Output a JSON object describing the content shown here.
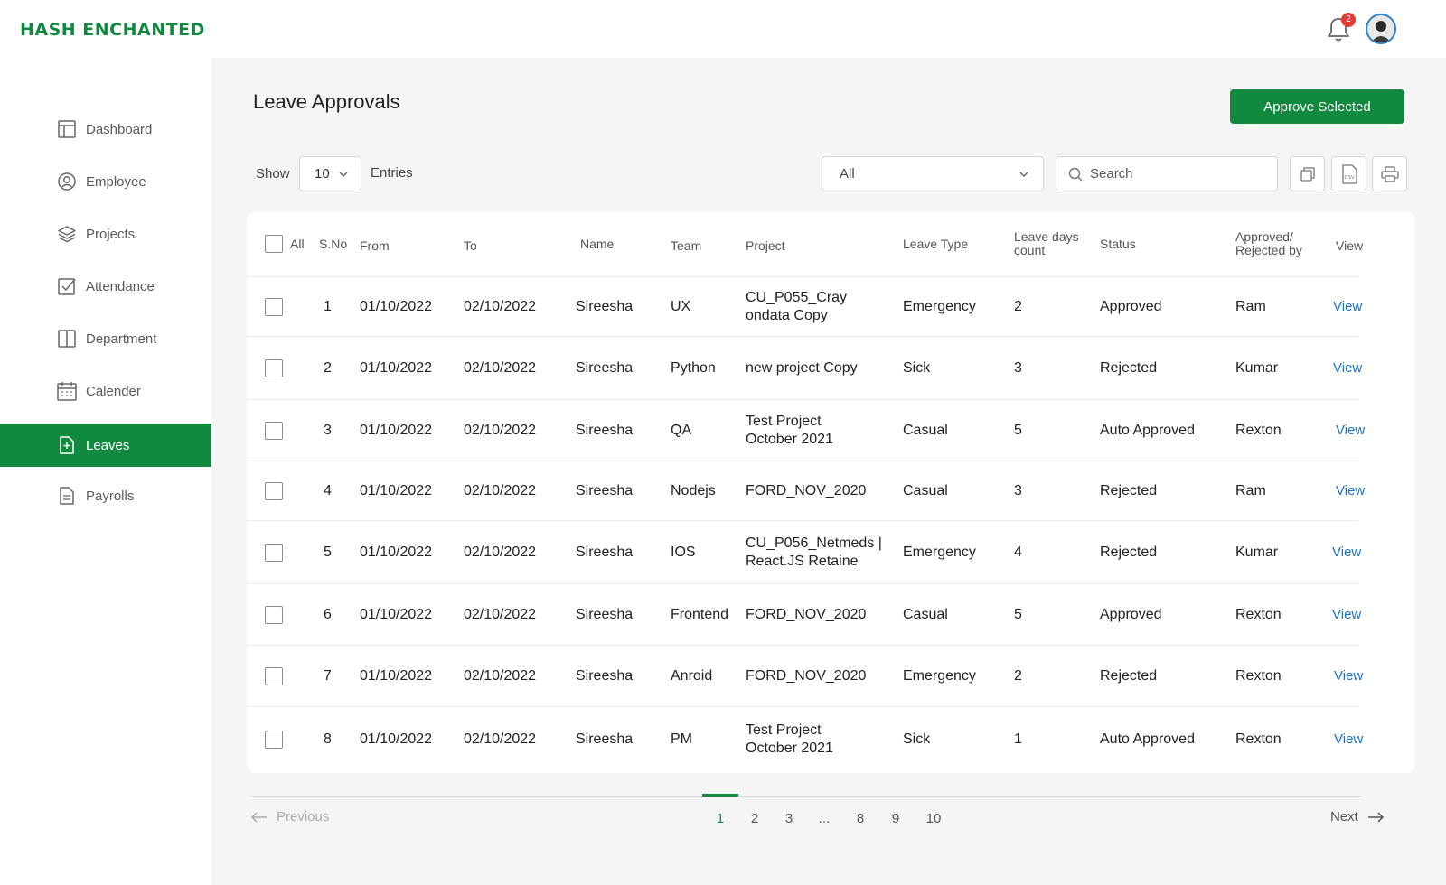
{
  "brand": {
    "logo_text": "HASH ENCHANTED",
    "accent": "#118a3f"
  },
  "header": {
    "notification_count": "2"
  },
  "sidebar": {
    "items": [
      {
        "label": "Dashboard",
        "icon": "dashboard-icon"
      },
      {
        "label": "Employee",
        "icon": "user-circle-icon"
      },
      {
        "label": "Projects",
        "icon": "layers-icon"
      },
      {
        "label": "Attendance",
        "icon": "checkbox-icon"
      },
      {
        "label": "Department",
        "icon": "columns-icon"
      },
      {
        "label": "Calender",
        "icon": "calendar-icon"
      },
      {
        "label": "Leaves",
        "icon": "file-plus-icon",
        "active": true
      },
      {
        "label": "Payrolls",
        "icon": "file-text-icon"
      }
    ]
  },
  "page": {
    "title": "Leave Approvals",
    "approve_button": "Approve Selected"
  },
  "controls": {
    "show_label": "Show",
    "entries_value": "10",
    "entries_label": "Entries",
    "filter_value": "All",
    "search_placeholder": "Search"
  },
  "table": {
    "headers": {
      "all": "All",
      "sno": "S.No",
      "from": "From",
      "to": "To",
      "name": "Name",
      "team": "Team",
      "project": "Project",
      "leave_type": "Leave Type",
      "leave_days_1": "Leave days",
      "leave_days_2": "count",
      "status": "Status",
      "approved_1": "Approved/",
      "approved_2": "Rejected by",
      "view": "View"
    },
    "rows": [
      {
        "sno": "1",
        "from": "01/10/2022",
        "to": "02/10/2022",
        "name": "Sireesha",
        "team": "UX",
        "project_1": "CU_P055_Cray",
        "project_2": "ondata Copy",
        "leave_type": "Emergency",
        "days": "2",
        "status": "Approved",
        "by": "Ram",
        "view": "View"
      },
      {
        "sno": "2",
        "from": "01/10/2022",
        "to": "02/10/2022",
        "name": "Sireesha",
        "team": "Python",
        "project_1": "new project Copy",
        "project_2": "",
        "leave_type": "Sick",
        "days": "3",
        "status": "Rejected",
        "by": "Kumar",
        "view": "View"
      },
      {
        "sno": "3",
        "from": "01/10/2022",
        "to": "02/10/2022",
        "name": "Sireesha",
        "team": "QA",
        "project_1": "Test Project",
        "project_2": "October 2021",
        "leave_type": "Casual",
        "days": "5",
        "status": "Auto Approved",
        "by": "Rexton",
        "view": "View"
      },
      {
        "sno": "4",
        "from": "01/10/2022",
        "to": "02/10/2022",
        "name": "Sireesha",
        "team": "Nodejs",
        "project_1": "FORD_NOV_2020",
        "project_2": "",
        "leave_type": "Casual",
        "days": "3",
        "status": "Rejected",
        "by": "Ram",
        "view": "View"
      },
      {
        "sno": "5",
        "from": "01/10/2022",
        "to": "02/10/2022",
        "name": "Sireesha",
        "team": "IOS",
        "project_1": "CU_P056_Netmeds |",
        "project_2": "React.JS Retaine",
        "leave_type": "Emergency",
        "days": "4",
        "status": "Rejected",
        "by": "Kumar",
        "view": "View"
      },
      {
        "sno": "6",
        "from": "01/10/2022",
        "to": "02/10/2022",
        "name": "Sireesha",
        "team": "Frontend",
        "project_1": "FORD_NOV_2020",
        "project_2": "",
        "leave_type": "Casual",
        "days": "5",
        "status": "Approved",
        "by": "Rexton",
        "view": "View"
      },
      {
        "sno": "7",
        "from": "01/10/2022",
        "to": "02/10/2022",
        "name": "Sireesha",
        "team": "Anroid",
        "project_1": "FORD_NOV_2020",
        "project_2": "",
        "leave_type": "Emergency",
        "days": "2",
        "status": "Rejected",
        "by": "Rexton",
        "view": "View"
      },
      {
        "sno": "8",
        "from": "01/10/2022",
        "to": "02/10/2022",
        "name": "Sireesha",
        "team": "PM",
        "project_1": "Test Project",
        "project_2": "October 2021",
        "leave_type": "Sick",
        "days": "1",
        "status": "Auto Approved",
        "by": "Rexton",
        "view": "View"
      }
    ]
  },
  "pagination": {
    "previous": "Previous",
    "next": "Next",
    "pages": [
      "1",
      "2",
      "3",
      "...",
      "8",
      "9",
      "10"
    ],
    "current": "1"
  }
}
